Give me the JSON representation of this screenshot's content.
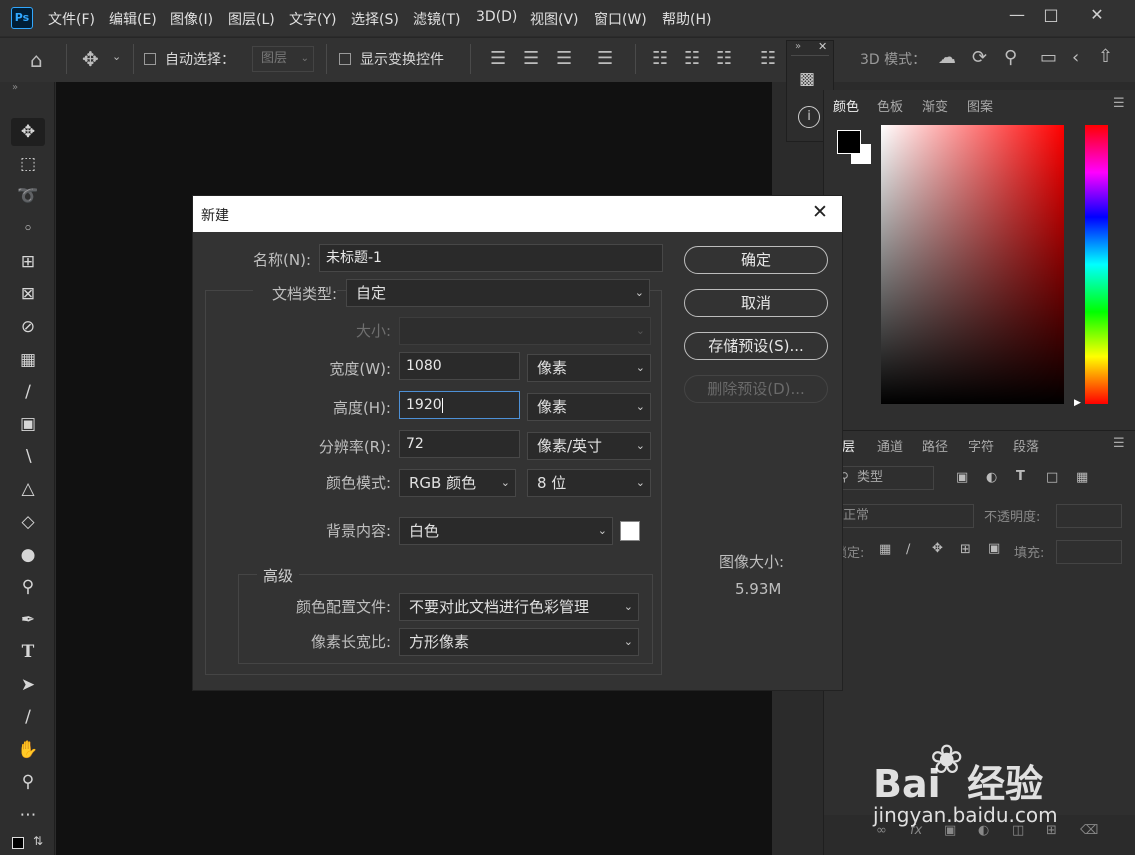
{
  "app": {
    "logo": "Ps"
  },
  "menus": [
    "文件(F)",
    "编辑(E)",
    "图像(I)",
    "图层(L)",
    "文字(Y)",
    "选择(S)",
    "滤镜(T)",
    "3D(D)",
    "视图(V)",
    "窗口(W)",
    "帮助(H)"
  ],
  "options_bar": {
    "auto_select_label": "自动选择：",
    "layer_dropdown": "图层",
    "show_transform_label": "显示变换控件",
    "mode_3d_label": "3D 模式："
  },
  "color_panel": {
    "tabs": [
      "颜色",
      "色板",
      "渐变",
      "图案"
    ]
  },
  "layers_panel": {
    "tabs": [
      "图层",
      "通道",
      "路径",
      "字符",
      "段落"
    ],
    "filter_label": "类型",
    "blend_mode": "正常",
    "opacity_label": "不透明度:",
    "lock_label": "锁定:",
    "fill_label": "填充:"
  },
  "dialog": {
    "title": "新建",
    "name_label": "名称(N):",
    "name_value": "未标题-1",
    "doc_type_label": "文档类型:",
    "doc_type_value": "自定",
    "size_label": "大小:",
    "width_label": "宽度(W):",
    "width_value": "1080",
    "width_unit": "像素",
    "height_label": "高度(H):",
    "height_value": "1920",
    "height_unit": "像素",
    "resolution_label": "分辨率(R):",
    "resolution_value": "72",
    "resolution_unit": "像素/英寸",
    "color_mode_label": "颜色模式:",
    "color_mode_value": "RGB 颜色",
    "bit_depth_value": "8 位",
    "background_label": "背景内容:",
    "background_value": "白色",
    "advanced_label": "高级",
    "color_profile_label": "颜色配置文件:",
    "color_profile_value": "不要对此文档进行色彩管理",
    "pixel_aspect_label": "像素长宽比:",
    "pixel_aspect_value": "方形像素",
    "image_size_label": "图像大小:",
    "image_size_value": "5.93M",
    "buttons": {
      "ok": "确定",
      "cancel": "取消",
      "save_preset": "存储预设(S)...",
      "delete_preset": "删除预设(D)..."
    }
  },
  "watermark": {
    "brand": "Bai  经验",
    "url": "jingyan.baidu.com"
  },
  "colors": {
    "accent": "#31a8ff",
    "focus": "#4d90d6",
    "background_swatch": "#ffffff",
    "foreground_swatch": "#000000"
  }
}
